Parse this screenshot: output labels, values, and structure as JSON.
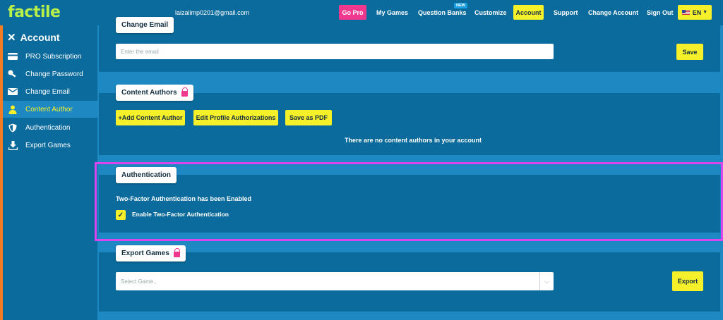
{
  "header": {
    "logo": "factile",
    "email": "laizalimp0201@gmail.com",
    "go_pro": "Go Pro",
    "my_games": "My Games",
    "question_banks": "Question Banks",
    "new_badge": "NEW",
    "customize": "Customize",
    "account": "Account",
    "support": "Support",
    "change_account": "Change Account",
    "sign_out": "Sign Out",
    "language": "EN"
  },
  "sidebar": {
    "title": "Account",
    "items": [
      {
        "label": "PRO Subscription",
        "icon": "credit-card-icon"
      },
      {
        "label": "Change Password",
        "icon": "key-icon"
      },
      {
        "label": "Change Email",
        "icon": "envelope-icon"
      },
      {
        "label": "Content Author",
        "icon": "user-icon"
      },
      {
        "label": "Authentication",
        "icon": "shield-icon"
      },
      {
        "label": "Export Games",
        "icon": "download-icon"
      }
    ]
  },
  "change_email": {
    "title": "Change Email",
    "placeholder": "Enter the email",
    "save_label": "Save"
  },
  "content_authors": {
    "title": "Content Authors",
    "add_label": "+Add Content Author",
    "edit_label": "Edit Profile Authorizations",
    "pdf_label": "Save as PDF",
    "empty_message": "There are no content authors in your account"
  },
  "authentication": {
    "title": "Authentication",
    "status": "Two-Factor Authentication has been Enabled",
    "checkbox_label": "Enable Two-Factor Authentication",
    "checked": true
  },
  "export_games": {
    "title": "Export Games",
    "select_placeholder": "Select Game..",
    "export_label": "Export"
  },
  "colors": {
    "accent_yellow": "#f5f02a",
    "pink": "#f0388f",
    "highlight": "#d946ef",
    "panel": "#0b6b9c",
    "background": "#1e88c2"
  }
}
